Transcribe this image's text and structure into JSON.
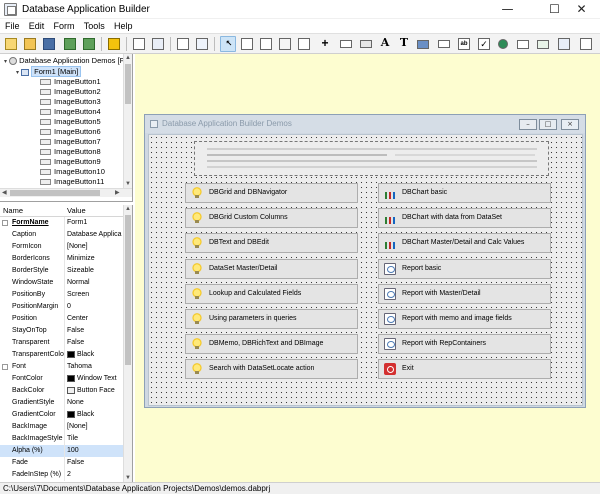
{
  "window": {
    "title": "Database Application Builder"
  },
  "menu": [
    "File",
    "Edit",
    "Form",
    "Tools",
    "Help"
  ],
  "toolbar_icons": [
    "new-icon",
    "open-folder-icon",
    "save-icon",
    "save-as-icon",
    "export-icon",
    "run-icon",
    "copy-icon",
    "paste-icon",
    "page-icon",
    "page-preview-icon",
    "pointer-icon",
    "panel-icon",
    "frame-icon",
    "image-icon",
    "move-icon",
    "button-icon",
    "edit-icon",
    "label-icon",
    "text-icon",
    "grid-icon",
    "image-button-icon",
    "dbedit-icon",
    "checkbox-icon",
    "radio-icon",
    "tabs-icon",
    "table-icon",
    "listbox-icon"
  ],
  "tree": {
    "root": "Database Application Demos [F",
    "form": "Form1 [Main]",
    "items": [
      "ImageButton1",
      "ImageButton2",
      "ImageButton3",
      "ImageButton4",
      "ImageButton5",
      "ImageButton6",
      "ImageButton7",
      "ImageButton8",
      "ImageButton9",
      "ImageButton10",
      "ImageButton11"
    ]
  },
  "properties": {
    "header": {
      "name": "Name",
      "value": "Value"
    },
    "rows": [
      {
        "name": "FormName",
        "value": "Form1",
        "bold": true,
        "expander": true
      },
      {
        "name": "Caption",
        "value": "Database Applica"
      },
      {
        "name": "FormIcon",
        "value": "[None]"
      },
      {
        "name": "BorderIcons",
        "value": "Minimize"
      },
      {
        "name": "BorderStyle",
        "value": "Sizeable"
      },
      {
        "name": "WindowState",
        "value": "Normal"
      },
      {
        "name": "PositionBy",
        "value": "Screen"
      },
      {
        "name": "PositionMargin",
        "value": "0"
      },
      {
        "name": "Position",
        "value": "Center"
      },
      {
        "name": "StayOnTop",
        "value": "False"
      },
      {
        "name": "Transparent",
        "value": "False"
      },
      {
        "name": "TransparentColor",
        "value": "Black",
        "swatch": "#000000"
      },
      {
        "name": "Font",
        "value": "Tahoma",
        "expander": true
      },
      {
        "name": "FontColor",
        "value": "Window Text",
        "swatch": "#000000"
      },
      {
        "name": "BackColor",
        "value": "Button Face",
        "swatch": "#f0f0f0"
      },
      {
        "name": "GradientStyle",
        "value": "None"
      },
      {
        "name": "GradientColor",
        "value": "Black",
        "swatch": "#000000"
      },
      {
        "name": "BackImage",
        "value": "[None]"
      },
      {
        "name": "BackImageStyle",
        "value": "Tile"
      },
      {
        "name": "Alpha (%)",
        "value": "100",
        "highlight": true
      },
      {
        "name": "Fade",
        "value": "False"
      },
      {
        "name": "FadeInStep (%)",
        "value": "2"
      }
    ]
  },
  "status": "C:\\Users\\7\\Documents\\Database Application Projects\\Demos\\demos.dabprj",
  "design_form": {
    "title": "Database Application Builder Demos",
    "left_buttons": [
      {
        "label": "DBGrid and DBNavigator",
        "icon": "bulb-icon"
      },
      {
        "label": "DBGrid Custom Columns",
        "icon": "bulb-icon"
      },
      {
        "label": "DBText and DBEdit",
        "icon": "bulb-icon"
      },
      {
        "label": "DataSet Master/Detail",
        "icon": "bulb-icon"
      },
      {
        "label": "Lookup and Calculated Fields",
        "icon": "bulb-icon"
      },
      {
        "label": "Using parameters in queries",
        "icon": "bulb-icon"
      },
      {
        "label": "DBMemo, DBRichText and DBImage",
        "icon": "bulb-icon"
      },
      {
        "label": "Search with DataSetLocate action",
        "icon": "bulb-icon"
      }
    ],
    "right_buttons": [
      {
        "label": "DBChart basic",
        "icon": "chart-icon"
      },
      {
        "label": "DBChart with data from DataSet",
        "icon": "chart-icon"
      },
      {
        "label": "DBChart Master/Detail and Calc Values",
        "icon": "chart-icon"
      },
      {
        "label": "Report basic",
        "icon": "report-icon"
      },
      {
        "label": "Report with Master/Detail",
        "icon": "report-icon"
      },
      {
        "label": "Report with memo and image fields",
        "icon": "report-icon"
      },
      {
        "label": "Report with RepContainers",
        "icon": "report-icon"
      },
      {
        "label": "Exit",
        "icon": "exit-icon"
      }
    ]
  },
  "colors": {
    "designer_background": "#fdfdd0",
    "form_frame": "#cfd8e2",
    "selection": "#cfe3fa"
  }
}
